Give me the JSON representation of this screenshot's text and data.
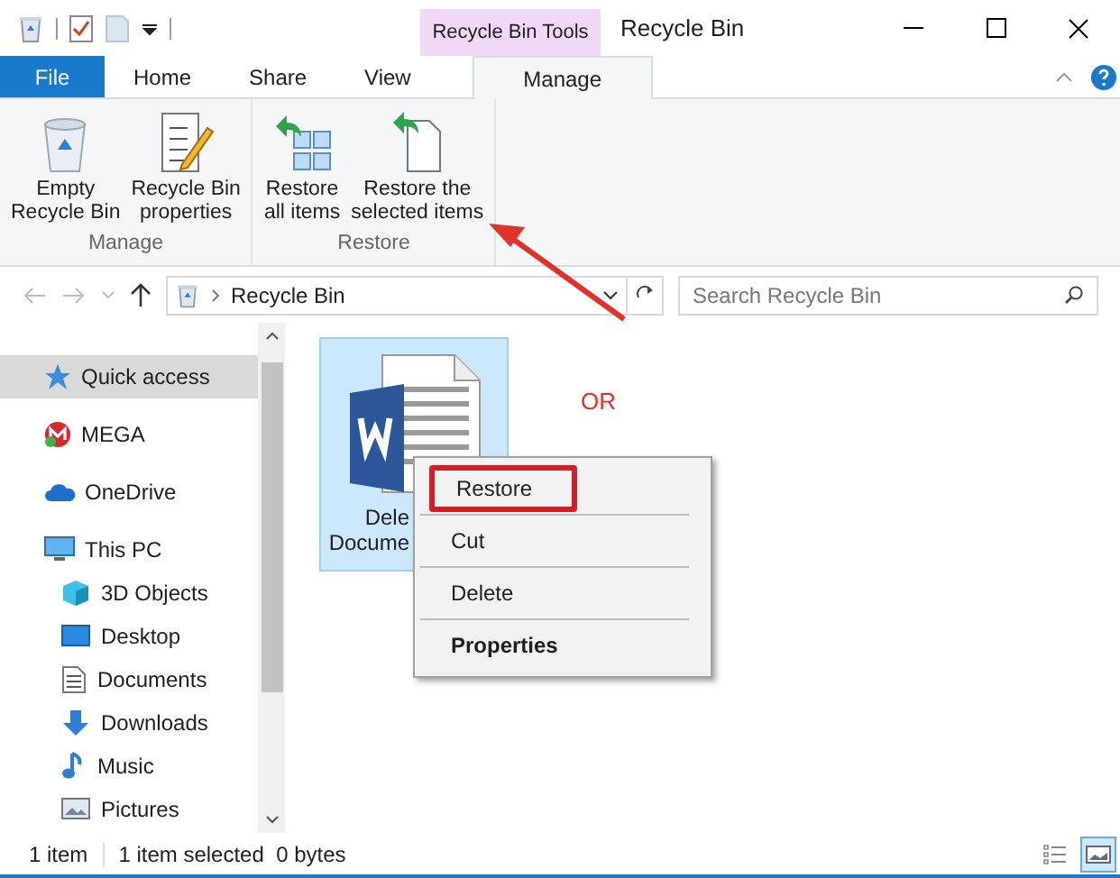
{
  "window": {
    "title": "Recycle Bin",
    "contextual_tab": "Recycle Bin Tools"
  },
  "tabs": [
    {
      "label": "File",
      "kind": "file",
      "selected": false
    },
    {
      "label": "Home",
      "kind": "tab",
      "selected": false
    },
    {
      "label": "Share",
      "kind": "tab",
      "selected": false
    },
    {
      "label": "View",
      "kind": "tab",
      "selected": false
    },
    {
      "label": "Manage",
      "kind": "tab",
      "selected": true
    }
  ],
  "ribbon": {
    "groups": [
      {
        "label": "Manage",
        "buttons": [
          {
            "lines": [
              "Empty",
              "Recycle Bin"
            ]
          },
          {
            "lines": [
              "Recycle Bin",
              "properties"
            ]
          }
        ]
      },
      {
        "label": "Restore",
        "buttons": [
          {
            "lines": [
              "Restore",
              "all items"
            ]
          },
          {
            "lines": [
              "Restore the",
              "selected items"
            ]
          }
        ]
      }
    ]
  },
  "address": {
    "path": "Recycle Bin",
    "search_placeholder": "Search Recycle Bin"
  },
  "sidebar": {
    "items": [
      {
        "label": "Quick access",
        "selected": true
      },
      {
        "label": "MEGA",
        "selected": false
      },
      {
        "label": "OneDrive",
        "selected": false
      },
      {
        "label": "This PC",
        "selected": false,
        "children": [
          {
            "label": "3D Objects",
            "selected": false
          },
          {
            "label": "Desktop",
            "selected": false
          },
          {
            "label": "Documents",
            "selected": false
          },
          {
            "label": "Downloads",
            "selected": false
          },
          {
            "label": "Music",
            "selected": false
          },
          {
            "label": "Pictures",
            "selected": false
          }
        ]
      }
    ]
  },
  "files": [
    {
      "label_lines": [
        "Dele",
        "Docume"
      ],
      "selected": true
    }
  ],
  "annotation": "OR",
  "context_menu": [
    {
      "label": "Restore",
      "highlighted": true,
      "default": false
    },
    {
      "label": "Cut",
      "highlighted": false,
      "default": false
    },
    {
      "label": "Delete",
      "highlighted": false,
      "default": false
    },
    {
      "label": "Properties",
      "highlighted": false,
      "default": true
    }
  ],
  "status_bar": {
    "count": "1 item",
    "selection": "1 item selected  0 bytes"
  },
  "views": [
    {
      "kind": "details",
      "selected": false
    },
    {
      "kind": "large_icons",
      "selected": true
    }
  ]
}
